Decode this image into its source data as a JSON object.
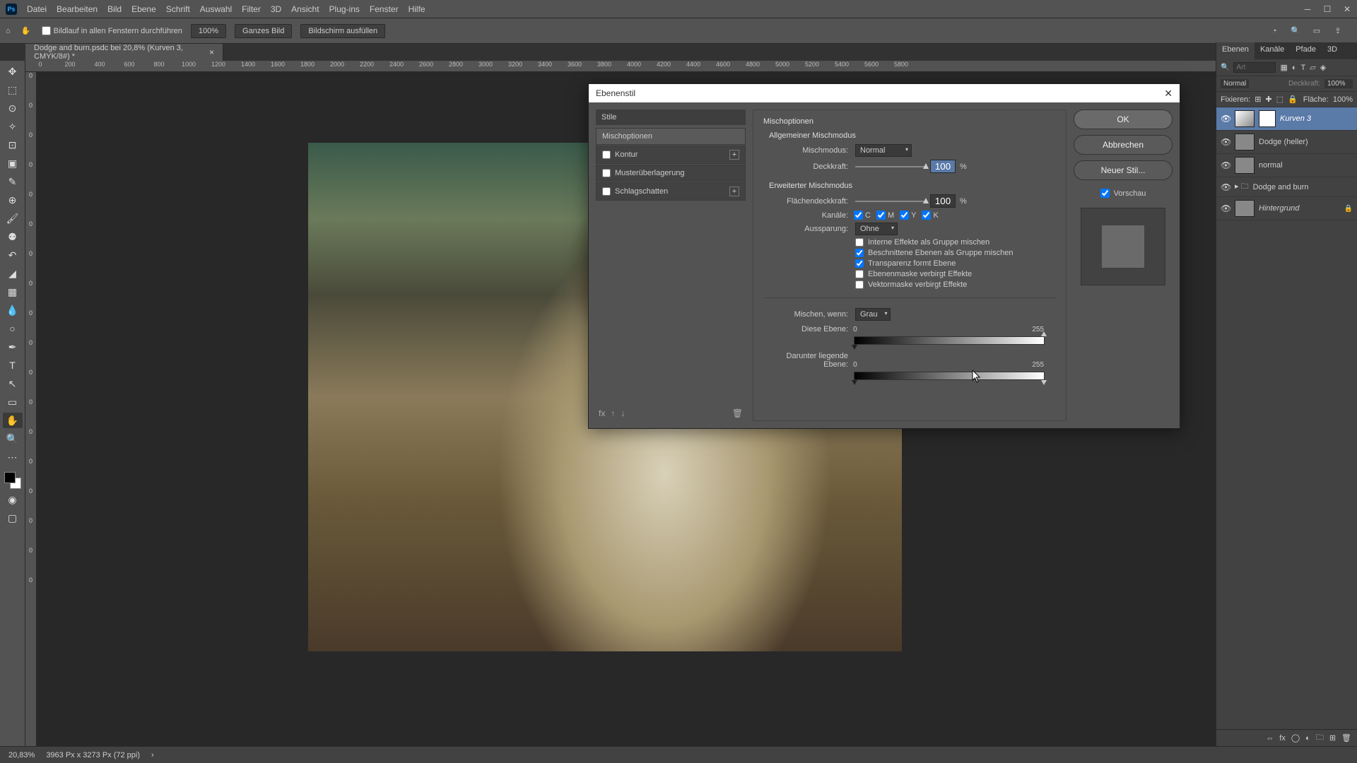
{
  "menu": [
    "Datei",
    "Bearbeiten",
    "Bild",
    "Ebene",
    "Schrift",
    "Auswahl",
    "Filter",
    "3D",
    "Ansicht",
    "Plug-ins",
    "Fenster",
    "Hilfe"
  ],
  "optbar": {
    "scroll_all": "Bildlauf in allen Fenstern durchführen",
    "zoom": "100%",
    "fit": "Ganzes Bild",
    "fill": "Bildschirm ausfüllen"
  },
  "doc_tab": "Dodge and burn.psdc bei 20,8% (Kurven 3, CMYK/8#) *",
  "ruler": [
    "0",
    "200",
    "400",
    "600",
    "800",
    "1000",
    "1200",
    "1400",
    "1600",
    "1800",
    "2000",
    "2200",
    "2400",
    "2600",
    "2800",
    "3000",
    "3200",
    "3400",
    "3600",
    "3800",
    "4000",
    "4200",
    "4400",
    "4600",
    "4800",
    "5000",
    "5200",
    "5400",
    "5600",
    "5800"
  ],
  "ruler_v": [
    "0",
    "0",
    "0",
    "0",
    "0",
    "0",
    "0",
    "0",
    "0",
    "0",
    "0",
    "0",
    "0",
    "0",
    "0",
    "0",
    "0",
    "0"
  ],
  "dialog": {
    "title": "Ebenenstil",
    "styles_header": "Stile",
    "styles": {
      "misch": "Mischoptionen",
      "kontur": "Kontur",
      "muster": "Musterüberlagerung",
      "schlag": "Schlagschatten"
    },
    "sect": "Mischoptionen",
    "general": "Allgemeiner Mischmodus",
    "mode_lbl": "Mischmodus:",
    "mode_val": "Normal",
    "opacity_lbl": "Deckkraft:",
    "opacity_val": "100",
    "pct": "%",
    "advanced": "Erweiterter Mischmodus",
    "fill_lbl": "Flächendeckkraft:",
    "fill_val": "100",
    "channels_lbl": "Kanäle:",
    "chan": [
      "C",
      "M",
      "Y",
      "K"
    ],
    "knockout_lbl": "Aussparung:",
    "knockout_val": "Ohne",
    "chk1": "Interne Effekte als Gruppe mischen",
    "chk2": "Beschnittene Ebenen als Gruppe mischen",
    "chk3": "Transparenz formt Ebene",
    "chk4": "Ebenenmaske verbirgt Effekte",
    "chk5": "Vektormaske verbirgt Effekte",
    "blendif_lbl": "Mischen, wenn:",
    "blendif_val": "Grau",
    "this_layer": "Diese Ebene:",
    "this_lo": "0",
    "this_hi": "255",
    "under_layer": "Darunter liegende Ebene:",
    "under_lo": "0",
    "under_hi": "255",
    "ok": "OK",
    "cancel": "Abbrechen",
    "new_style": "Neuer Stil...",
    "preview": "Vorschau"
  },
  "panels": {
    "tabs": [
      "Ebenen",
      "Kanäle",
      "Pfade",
      "3D"
    ],
    "search_ph": "Art",
    "blend_mode": "Normal",
    "opacity_lbl": "Deckkraft:",
    "opacity_val": "100%",
    "lock_lbl": "Fixieren:",
    "fill_lbl": "Fläche:",
    "fill_val": "100%",
    "layers": [
      {
        "name": "Kurven 3",
        "sel": true,
        "mask": true,
        "italic": true
      },
      {
        "name": "Dodge (heller)",
        "sel": false,
        "mask": false,
        "italic": false
      },
      {
        "name": "normal",
        "sel": false,
        "mask": false,
        "italic": false
      },
      {
        "name": "Dodge and burn",
        "sel": false,
        "mask": false,
        "italic": false,
        "folder": true
      },
      {
        "name": "Hintergrund",
        "sel": false,
        "mask": false,
        "italic": true,
        "lock": true
      }
    ]
  },
  "status": {
    "zoom": "20,83%",
    "doc": "3963 Px x 3273 Px (72 ppi)"
  }
}
